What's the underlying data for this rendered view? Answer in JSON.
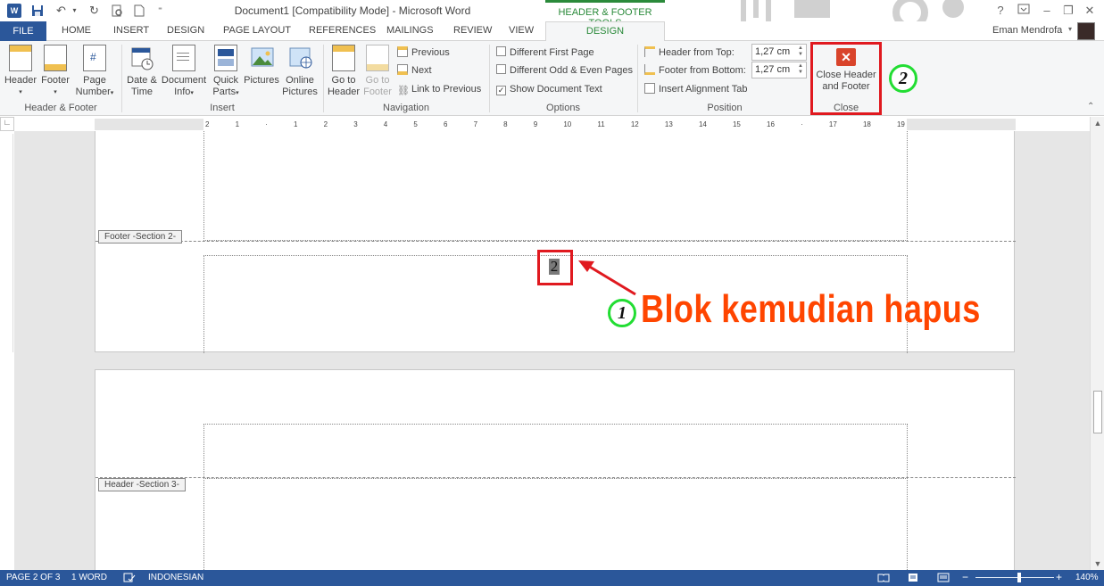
{
  "window": {
    "title": "Document1 [Compatibility Mode] - Microsoft Word",
    "contextual_tab_group": "HEADER & FOOTER TOOLS",
    "user_name": "Eman Mendrofa",
    "help": "?",
    "min": "–",
    "restore": "❐",
    "close": "✕"
  },
  "tabs": {
    "file": "FILE",
    "home": "HOME",
    "insert": "INSERT",
    "design": "DESIGN",
    "page_layout": "PAGE LAYOUT",
    "references": "REFERENCES",
    "mailings": "MAILINGS",
    "review": "REVIEW",
    "view": "VIEW",
    "design_active": "DESIGN"
  },
  "ribbon": {
    "header_footer": {
      "label": "Header & Footer",
      "header": "Header",
      "footer": "Footer",
      "page_number_1": "Page",
      "page_number_2": "Number"
    },
    "insert": {
      "label": "Insert",
      "date_time_1": "Date &",
      "date_time_2": "Time",
      "document_info_1": "Document",
      "document_info_2": "Info",
      "quick_parts_1": "Quick",
      "quick_parts_2": "Parts",
      "pictures": "Pictures",
      "online_pictures_1": "Online",
      "online_pictures_2": "Pictures"
    },
    "navigation": {
      "label": "Navigation",
      "go_to_header_1": "Go to",
      "go_to_header_2": "Header",
      "go_to_footer_1": "Go to",
      "go_to_footer_2": "Footer",
      "previous": "Previous",
      "next": "Next",
      "link_to_previous": "Link to Previous"
    },
    "options": {
      "label": "Options",
      "different_first_page": "Different First Page",
      "different_odd_even": "Different Odd & Even Pages",
      "show_document_text": "Show Document Text",
      "show_document_text_checked": true
    },
    "position": {
      "label": "Position",
      "header_from_top": "Header from Top:",
      "header_from_top_value": "1,27 cm",
      "footer_from_bottom": "Footer from Bottom:",
      "footer_from_bottom_value": "1,27 cm",
      "insert_alignment_tab": "Insert Alignment Tab"
    },
    "close": {
      "label": "Close",
      "close_hf_1": "Close Header",
      "close_hf_2": "and Footer"
    }
  },
  "ruler": {
    "numbers": [
      "2",
      "1",
      "",
      "1",
      "2",
      "3",
      "4",
      "5",
      "6",
      "7",
      "8",
      "9",
      "10",
      "11",
      "12",
      "13",
      "14",
      "15",
      "16",
      "",
      "17",
      "18",
      "19"
    ]
  },
  "document": {
    "footer_section_label": "Footer -Section 2-",
    "header_section_label": "Header -Section 3-",
    "page_number_value": "2"
  },
  "annotations": {
    "instruction_text": "Blok kemudian hapus",
    "step_1": "1",
    "step_2": "2",
    "highlight_color": "#e0191f",
    "text_color": "#ff4500",
    "circle_color": "#22dd33"
  },
  "statusbar": {
    "page": "PAGE 2 OF 3",
    "words": "1 WORD",
    "language": "INDONESIAN",
    "zoom": "140%"
  }
}
